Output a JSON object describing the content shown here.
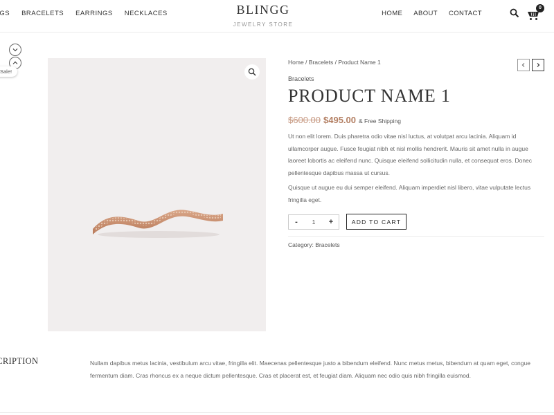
{
  "header": {
    "nav_left": [
      "NGS",
      "BRACELETS",
      "EARRINGS",
      "NECKLACES"
    ],
    "logo_title": "BLINGG",
    "logo_subtitle": "JEWELRY STORE",
    "nav_right": [
      "HOME",
      "ABOUT",
      "CONTACT"
    ],
    "cart_count": "0"
  },
  "sale_badge": "Sale!",
  "breadcrumb": {
    "home": "Home",
    "sep1": " / ",
    "category": "Bracelets",
    "sep2": " / ",
    "current": "Product Name 1"
  },
  "product": {
    "category_link": "Bracelets",
    "title": "PRODUCT NAME 1",
    "old_price": "$600.00",
    "new_price": "$495.00",
    "shipping": "& Free Shipping",
    "short_description": "Ut non elit lorem. Duis pharetra odio vitae nisl luctus, at volutpat arcu lacinia. Aliquam id ullamcorper augue. Fusce feugiat nibh et nisl mollis hendrerit. Mauris sit amet nulla in augue laoreet lobortis ac eleifend nunc. Quisque eleifend sollicitudin nulla, et consequat eros. Donec pellentesque dapibus massa ut cursus.",
    "short_description_2": "Quisque ut augue eu dui semper eleifend. Aliquam imperdiet nisl libero, vitae vulputate lectus fringilla eget.",
    "quantity": "1",
    "qty_minus": "-",
    "qty_plus": "+",
    "add_to_cart": "ADD TO CART",
    "meta_label": "Category: ",
    "meta_category": "Bracelets"
  },
  "description": {
    "tab_label": "SCRIPTION",
    "text": "Nullam dapibus metus lacinia, vestibulum arcu vitae, fringilla elit. Maecenas pellentesque justo a bibendum eleifend. Nunc metus metus, bibendum at quam eget, congue fermentum diam. Cras rhoncus ex a neque dictum pellentesque. Cras et placerat est, et feugiat diam. Aliquam nec odio quis nibh fringilla euismod."
  },
  "colors": {
    "old_price": "#c79a83",
    "new_price": "#b37f63",
    "image_bg": "#f1eeee"
  },
  "icons": [
    "chevron-down-icon",
    "chevron-up-icon",
    "search-icon",
    "cart-icon",
    "zoom-icon",
    "chevron-left-icon",
    "chevron-right-icon"
  ]
}
